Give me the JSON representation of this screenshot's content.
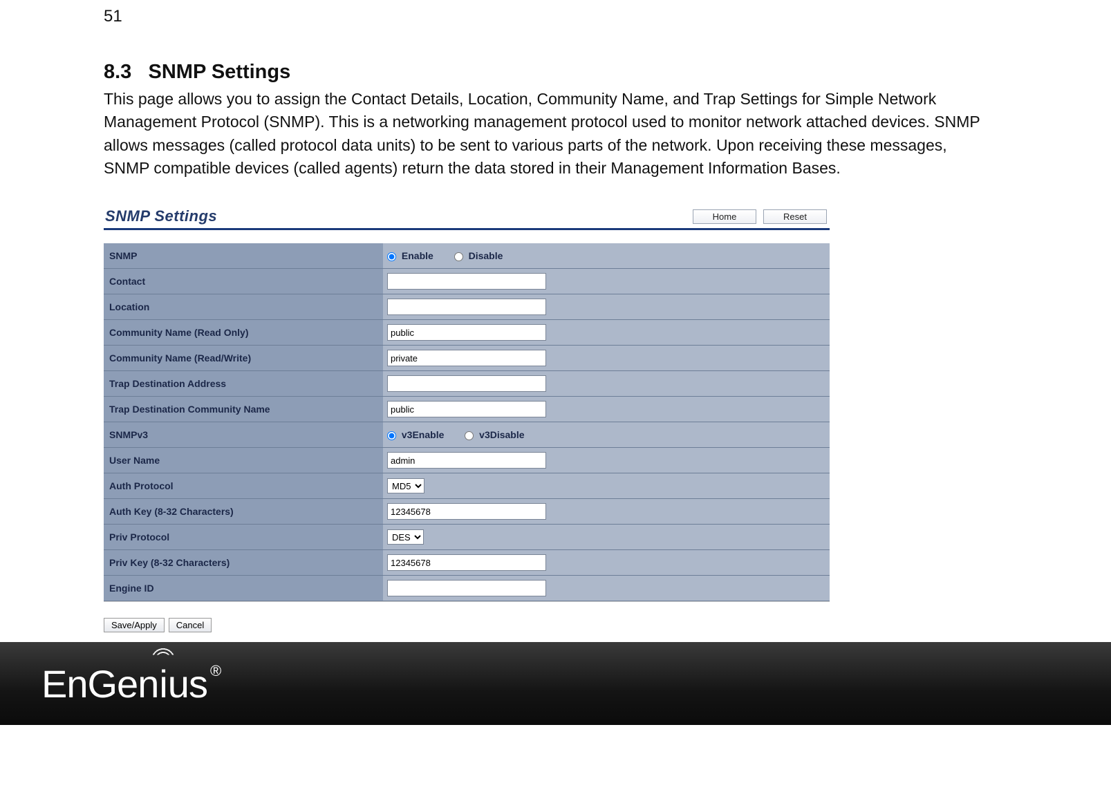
{
  "page_number": "51",
  "section_number": "8.3",
  "section_title": "SNMP Settings",
  "body_text": "This page allows you to assign the Contact Details, Location, Community Name, and Trap Settings for Simple Network Management Protocol (SNMP). This is a networking management protocol used to monitor network attached devices. SNMP allows messages (called protocol data units) to be sent to various parts of the network. Upon receiving these messages, SNMP compatible devices (called agents) return the data stored in their Management Information Bases.",
  "screenshot": {
    "title": "SNMP Settings",
    "home_btn": "Home",
    "reset_btn": "Reset",
    "rows": {
      "snmp": {
        "label": "SNMP",
        "opt_enable": "Enable",
        "opt_disable": "Disable"
      },
      "contact": {
        "label": "Contact",
        "value": ""
      },
      "location": {
        "label": "Location",
        "value": ""
      },
      "comm_ro": {
        "label": "Community Name (Read Only)",
        "value": "public"
      },
      "comm_rw": {
        "label": "Community Name (Read/Write)",
        "value": "private"
      },
      "trap_addr": {
        "label": "Trap Destination Address",
        "value": ""
      },
      "trap_comm": {
        "label": "Trap Destination Community Name",
        "value": "public"
      },
      "snmpv3": {
        "label": "SNMPv3",
        "opt_enable": "v3Enable",
        "opt_disable": "v3Disable"
      },
      "user": {
        "label": "User Name",
        "value": "admin"
      },
      "auth_proto": {
        "label": "Auth Protocol",
        "value": "MD5"
      },
      "auth_key": {
        "label": "Auth Key (8-32 Characters)",
        "value": "12345678"
      },
      "priv_proto": {
        "label": "Priv Protocol",
        "value": "DES"
      },
      "priv_key": {
        "label": "Priv Key (8-32 Characters)",
        "value": "12345678"
      },
      "engine": {
        "label": "Engine ID",
        "value": ""
      }
    },
    "save_btn": "Save/Apply",
    "cancel_btn": "Cancel"
  },
  "brand": {
    "name": "EnGenius",
    "reg": "®"
  }
}
